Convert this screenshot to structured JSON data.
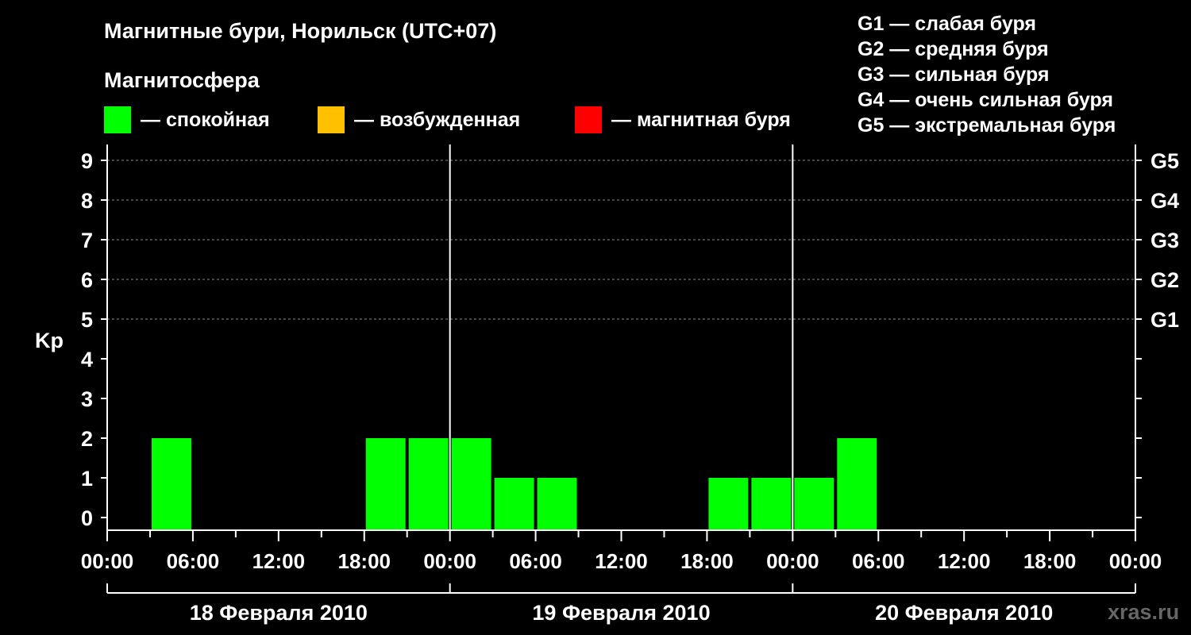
{
  "header": {
    "title": "Магнитные бури, Норильск (UTC+07)",
    "magnetosphere_label": "Магнитосфера"
  },
  "legend": [
    {
      "label": "— спокойная",
      "color": "#00ff00"
    },
    {
      "label": "— возбужденная",
      "color": "#ffc000"
    },
    {
      "label": "— магнитная буря",
      "color": "#ff0000"
    }
  ],
  "g_scale": [
    "G1 — слабая буря",
    "G2 — средняя буря",
    "G3 — сильная буря",
    "G4 — очень сильная буря",
    "G5 — экстремальная буря"
  ],
  "watermark": "xras.ru",
  "chart_data": {
    "type": "bar",
    "ylabel": "Kp",
    "ylim": [
      0,
      9
    ],
    "yticks": [
      0,
      1,
      2,
      3,
      4,
      5,
      6,
      7,
      8,
      9
    ],
    "right_ticks": [
      {
        "kp": 5,
        "label": "G1"
      },
      {
        "kp": 6,
        "label": "G2"
      },
      {
        "kp": 7,
        "label": "G3"
      },
      {
        "kp": 8,
        "label": "G4"
      },
      {
        "kp": 9,
        "label": "G5"
      }
    ],
    "x_tick_labels": [
      "00:00",
      "06:00",
      "12:00",
      "18:00",
      "00:00",
      "06:00",
      "12:00",
      "18:00",
      "00:00",
      "06:00",
      "12:00",
      "18:00",
      "00:00"
    ],
    "days": [
      "18 Февраля 2010",
      "19 Февраля 2010",
      "20 Февраля 2010"
    ],
    "bar_color": "#00ff00",
    "grid": "dashed horizontal at Kp 5–9",
    "bars": [
      {
        "period": "18 Февраля 2010 03:00–06:00",
        "kp": 2
      },
      {
        "period": "18 Февраля 2010 18:00–21:00",
        "kp": 2
      },
      {
        "period": "18 Февраля 2010 21:00–24:00",
        "kp": 2
      },
      {
        "period": "19 Февраля 2010 00:00–03:00",
        "kp": 2
      },
      {
        "period": "19 Февраля 2010 03:00–06:00",
        "kp": 1
      },
      {
        "period": "19 Февраля 2010 06:00–09:00",
        "kp": 1
      },
      {
        "period": "19 Февраля 2010 18:00–21:00",
        "kp": 1
      },
      {
        "period": "19 Февраля 2010 21:00–24:00",
        "kp": 1
      },
      {
        "period": "20 Февраля 2010 00:00–03:00",
        "kp": 1
      },
      {
        "period": "20 Февраля 2010 03:00–06:00",
        "kp": 2
      }
    ]
  }
}
